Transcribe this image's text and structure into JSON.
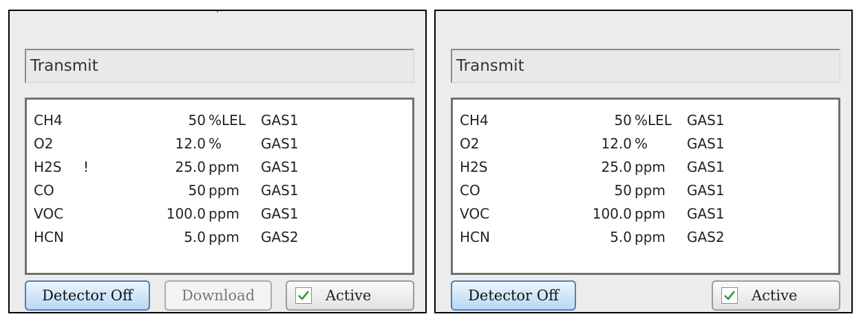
{
  "left_panel": {
    "status_text": "Transmit",
    "readings": [
      {
        "gas": "CH4",
        "flag": "",
        "value": "50",
        "unit": "%LEL",
        "channel": "GAS1"
      },
      {
        "gas": "O2",
        "flag": "",
        "value": "12.0",
        "unit": "%",
        "channel": "GAS1"
      },
      {
        "gas": "H2S",
        "flag": "!",
        "value": "25.0",
        "unit": "ppm",
        "channel": "GAS1"
      },
      {
        "gas": "CO",
        "flag": "",
        "value": "50",
        "unit": "ppm",
        "channel": "GAS1"
      },
      {
        "gas": "VOC",
        "flag": "",
        "value": "100.0",
        "unit": "ppm",
        "channel": "GAS1"
      },
      {
        "gas": "HCN",
        "flag": "",
        "value": "5.0",
        "unit": "ppm",
        "channel": "GAS2"
      }
    ],
    "buttons": {
      "detector_off": "Detector Off",
      "download": "Download",
      "active": "Active"
    },
    "active_checked": true
  },
  "right_panel": {
    "status_text": "Transmit",
    "readings": [
      {
        "gas": "CH4",
        "flag": "",
        "value": "50",
        "unit": "%LEL",
        "channel": "GAS1"
      },
      {
        "gas": "O2",
        "flag": "",
        "value": "12.0",
        "unit": "%",
        "channel": "GAS1"
      },
      {
        "gas": "H2S",
        "flag": "",
        "value": "25.0",
        "unit": "ppm",
        "channel": "GAS1"
      },
      {
        "gas": "CO",
        "flag": "",
        "value": "50",
        "unit": "ppm",
        "channel": "GAS1"
      },
      {
        "gas": "VOC",
        "flag": "",
        "value": "100.0",
        "unit": "ppm",
        "channel": "GAS1"
      },
      {
        "gas": "HCN",
        "flag": "",
        "value": "5.0",
        "unit": "ppm",
        "channel": "GAS2"
      }
    ],
    "buttons": {
      "detector_off": "Detector Off",
      "active": "Active"
    },
    "active_checked": true
  },
  "icons": {
    "checkbox": "checkmark-icon",
    "check_color": "#2e9a2e"
  },
  "colors": {
    "detector_button_border": "#4d7fb7",
    "panel_background": "#ececec"
  }
}
